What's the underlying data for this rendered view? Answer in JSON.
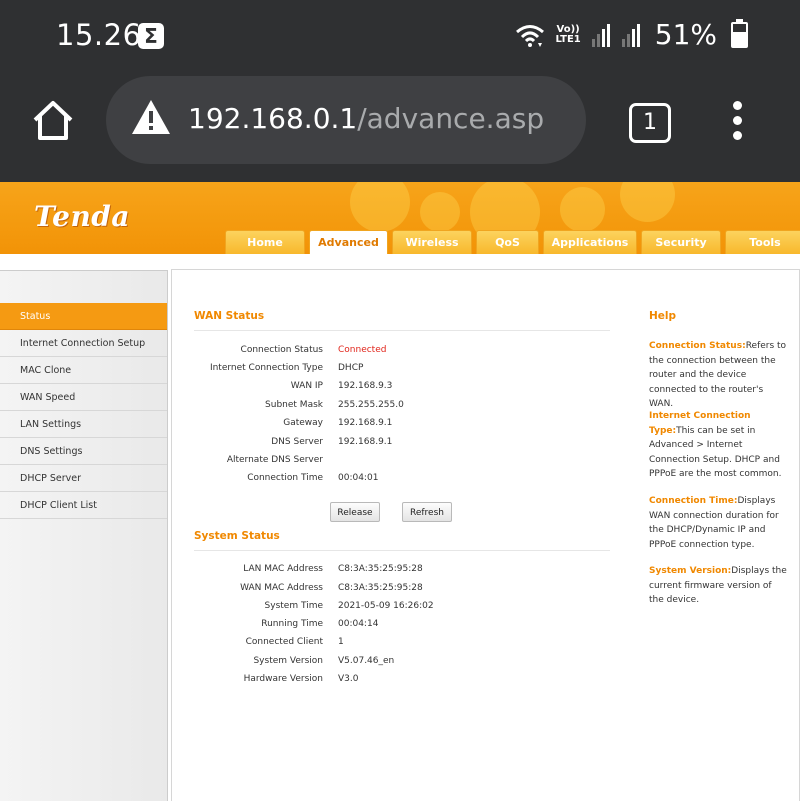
{
  "status_bar": {
    "time": "15.26",
    "notification_glyph": "Σ",
    "volte_top": "Vo))",
    "volte_bottom": "LTE1",
    "battery": "51%"
  },
  "browser": {
    "url_host": "192.168.0.1",
    "url_path": "/advance.asp",
    "tab_count": "1"
  },
  "brand": {
    "logo": "Tenda",
    "accent": "#f49a0e"
  },
  "nav": {
    "tabs": [
      {
        "label": "Home"
      },
      {
        "label": "Advanced"
      },
      {
        "label": "Wireless"
      },
      {
        "label": "QoS"
      },
      {
        "label": "Applications"
      },
      {
        "label": "Security"
      },
      {
        "label": "Tools"
      }
    ],
    "active": "Advanced"
  },
  "sidebar": {
    "items": [
      {
        "label": "Status"
      },
      {
        "label": "Internet Connection Setup"
      },
      {
        "label": "MAC Clone"
      },
      {
        "label": "WAN Speed"
      },
      {
        "label": "LAN Settings"
      },
      {
        "label": "DNS Settings"
      },
      {
        "label": "DHCP Server"
      },
      {
        "label": "DHCP Client List"
      }
    ],
    "active": "Status"
  },
  "wan": {
    "title": "WAN Status",
    "rows": [
      {
        "label": "Connection Status",
        "value": "Connected"
      },
      {
        "label": "Internet Connection Type",
        "value": "DHCP"
      },
      {
        "label": "WAN IP",
        "value": "192.168.9.3"
      },
      {
        "label": "Subnet Mask",
        "value": "255.255.255.0"
      },
      {
        "label": "Gateway",
        "value": "192.168.9.1"
      },
      {
        "label": "DNS Server",
        "value": "192.168.9.1"
      },
      {
        "label": "Alternate DNS Server",
        "value": ""
      },
      {
        "label": "Connection Time",
        "value": "00:04:01"
      }
    ],
    "release_label": "Release",
    "refresh_label": "Refresh"
  },
  "system": {
    "title": "System Status",
    "rows": [
      {
        "label": "LAN MAC Address",
        "value": "C8:3A:35:25:95:28"
      },
      {
        "label": "WAN MAC Address",
        "value": "C8:3A:35:25:95:28"
      },
      {
        "label": "System Time",
        "value": "2021-05-09 16:26:02"
      },
      {
        "label": "Running Time",
        "value": "00:04:14"
      },
      {
        "label": "Connected Client",
        "value": "1"
      },
      {
        "label": "System Version",
        "value": "V5.07.46_en"
      },
      {
        "label": "Hardware Version",
        "value": "V3.0"
      }
    ]
  },
  "help": {
    "title": "Help",
    "entries": [
      {
        "term": "Connection Status:",
        "text": "Refers to the connection between the router and the device connected to the router's WAN."
      },
      {
        "term": "Internet Connection Type:",
        "text": "This can be set in Advanced > Internet Connection Setup. DHCP and PPPoE are the most common."
      },
      {
        "term": "Connection Time:",
        "text": "Displays WAN connection duration for the DHCP/Dynamic IP and PPPoE connection type."
      },
      {
        "term": "System Version:",
        "text": "Displays the current firmware version of the device."
      }
    ]
  }
}
